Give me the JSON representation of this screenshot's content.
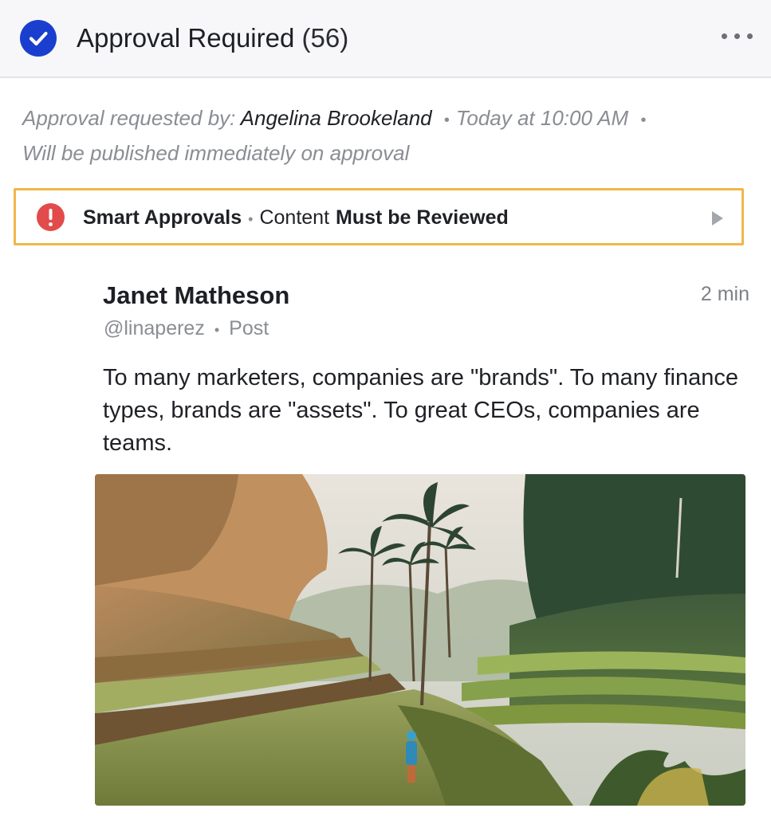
{
  "header": {
    "title": "Approval Required",
    "count": "(56)",
    "check_icon": "check-circle-icon",
    "more_icon": "more-horizontal-icon",
    "accent": "#1a3fcf"
  },
  "meta": {
    "requested_by_label": "Approval requested by:",
    "author": "Angelina Brookeland",
    "separator": "•",
    "time": "Today at 10:00 AM",
    "publish_note": "Will be published immediately on approval"
  },
  "smart_approval": {
    "title": "Smart Approvals",
    "separator": "•",
    "content_label": "Content",
    "status": "Must be Reviewed",
    "alert_icon": "alert-circle-icon",
    "expand_icon": "play-arrow-icon",
    "border_color": "#f1b64a",
    "alert_color": "#e24b4b"
  },
  "post": {
    "name": "Janet Matheson",
    "time": "2 min",
    "handle": "@linaperez",
    "separator": "•",
    "type": "Post",
    "body": "To many marketers, companies are \"brands\". To many finance types, brands are \"assets\". To great CEOs, companies are teams.",
    "image": "rice-terrace-palm-trees-photo"
  }
}
